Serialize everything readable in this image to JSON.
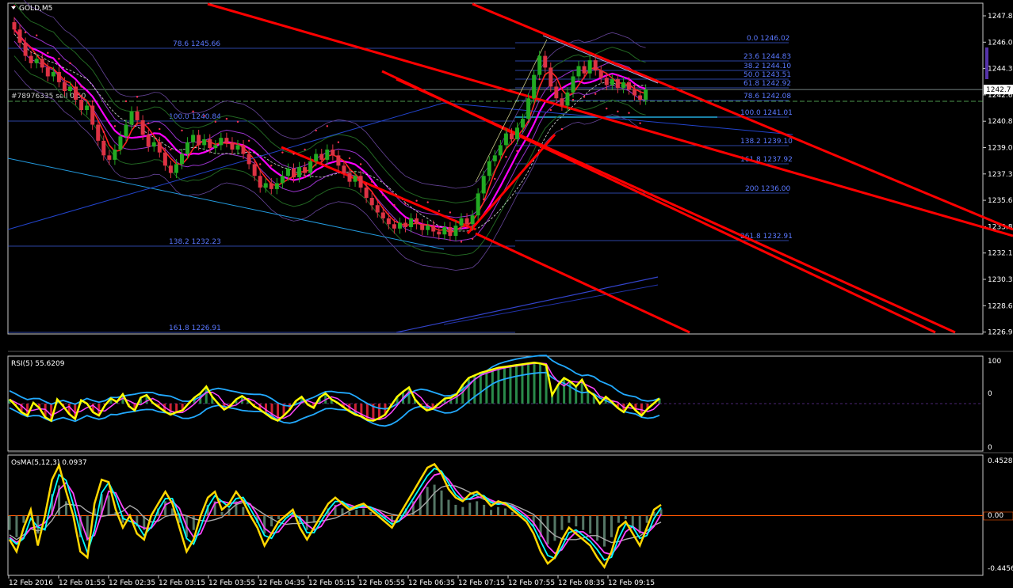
{
  "window": {
    "title": "GOLD,M5"
  },
  "colors": {
    "background": "#000000",
    "frame": "#c8c8c8",
    "bull": "#22aa22",
    "bear": "#dd3344",
    "channel": "#ff0000",
    "fib": "#3a5bd9",
    "fib_text": "#5a78ff",
    "rsi_main": "#ffff00",
    "rsi_band": "#22aaff",
    "osma_main": "#ffd700",
    "osma_sig1": "#00ffff",
    "osma_sig2": "#ff44ff",
    "osma_sig3": "#aaaaaa",
    "zero_line": "#ff5500",
    "axis_text": "#ffffff"
  },
  "price_axis": {
    "ticks": [
      "1247.8",
      "1246.0",
      "1244.3",
      "1242.6",
      "1240.8",
      "1239.0",
      "1237.3",
      "1235.6",
      "1233.8",
      "1232.1",
      "1230.3",
      "1228.6",
      "1226.9"
    ],
    "current_price": "1242.7"
  },
  "fib_labels": [
    "0.0 1246.02",
    "23.6 1244.83",
    "38.2 1244.10",
    "50.0 1243.51",
    "61.8 1242.92",
    "78.6 1242.08",
    "100.0 1241.01",
    "138.2 1239.10",
    "161.8 1237.92",
    "200 1236.00",
    "261.8 1232.91",
    "78.6 1245.66",
    "100.0 1240.84",
    "138.2 1232.23",
    "161.8 1226.91"
  ],
  "order_label": "#78976335 sell 0.50",
  "rsi": {
    "label": "RSI(5) 55.6209",
    "ticks": [
      "100",
      "0",
      "0"
    ]
  },
  "osma": {
    "label": "OsMA(5,12,3) 0.0937",
    "ticks": [
      "0.4528",
      "0.00",
      "-0.4456"
    ]
  },
  "time_axis": [
    "12 Feb 2016",
    "12 Feb 01:55",
    "12 Feb 02:35",
    "12 Feb 03:15",
    "12 Feb 03:55",
    "12 Feb 04:35",
    "12 Feb 05:15",
    "12 Feb 05:55",
    "12 Feb 06:35",
    "12 Feb 07:15",
    "12 Feb 07:55",
    "12 Feb 08:35",
    "12 Feb 09:15"
  ],
  "chart_data": [
    {
      "type": "candlestick",
      "title": "GOLD,M5",
      "ylim": [
        1226.0,
        1248.6
      ],
      "close": [
        1246.8,
        1245.9,
        1245.0,
        1244.5,
        1244.8,
        1244.2,
        1243.6,
        1243.9,
        1243.2,
        1242.6,
        1242.9,
        1242.0,
        1241.3,
        1241.6,
        1240.3,
        1239.2,
        1238.2,
        1237.9,
        1238.6,
        1239.5,
        1240.3,
        1241.2,
        1240.6,
        1239.6,
        1238.8,
        1239.1,
        1238.4,
        1237.5,
        1237.0,
        1237.6,
        1238.3,
        1239.1,
        1239.6,
        1238.9,
        1239.3,
        1238.7,
        1238.9,
        1239.4,
        1239.1,
        1238.6,
        1238.9,
        1238.3,
        1237.6,
        1236.8,
        1236.0,
        1236.3,
        1235.9,
        1236.3,
        1236.8,
        1237.3,
        1236.7,
        1237.4,
        1237.0,
        1237.8,
        1238.3,
        1237.9,
        1238.6,
        1238.2,
        1237.5,
        1237.0,
        1236.4,
        1236.8,
        1236.0,
        1235.3,
        1234.8,
        1234.3,
        1233.9,
        1233.5,
        1233.2,
        1233.6,
        1233.3,
        1233.9,
        1233.5,
        1233.1,
        1233.4,
        1233.0,
        1232.8,
        1233.3,
        1232.7,
        1233.4,
        1233.9,
        1233.5,
        1234.1,
        1235.6,
        1236.8,
        1237.8,
        1238.2,
        1238.9,
        1239.7,
        1239.3,
        1240.1,
        1240.7,
        1242.1,
        1243.7,
        1245.0,
        1244.2,
        1242.9,
        1242.1,
        1241.6,
        1242.5,
        1243.6,
        1244.3,
        1243.8,
        1244.7,
        1244.0,
        1243.5,
        1243.0,
        1243.4,
        1242.8,
        1243.2,
        1242.7,
        1242.3,
        1242.0,
        1242.7
      ]
    },
    {
      "type": "line",
      "title": "RSI(5) 55.6209",
      "ylim": [
        0,
        100
      ],
      "series": [
        {
          "values": [
            55,
            48,
            40,
            36,
            51,
            45,
            34,
            30,
            55,
            47,
            38,
            32,
            54,
            50,
            40,
            36,
            48,
            56,
            52,
            61,
            47,
            42,
            57,
            60,
            51,
            46,
            41,
            37,
            40,
            42,
            50,
            57,
            62,
            70,
            58,
            50,
            43,
            47,
            55,
            59,
            54,
            47,
            43,
            38,
            33,
            30,
            36,
            43,
            53,
            58,
            49,
            45,
            57,
            62,
            55,
            51,
            46,
            41,
            37,
            35,
            31,
            30,
            33,
            37,
            48,
            58,
            64,
            69,
            55,
            47,
            42,
            44,
            50,
            56,
            57,
            61,
            72,
            80,
            83,
            86,
            88,
            90,
            92,
            93,
            94,
            95,
            96,
            97,
            98,
            97,
            95,
            60,
            72,
            80,
            76,
            70,
            78,
            65,
            60,
            50,
            58,
            52,
            45,
            40,
            50,
            42,
            36,
            44,
            50,
            56
          ]
        }
      ]
    },
    {
      "type": "line",
      "title": "OsMA(5,12,3) 0.0937",
      "ylim": [
        -0.4456,
        0.4528
      ],
      "series": [
        {
          "values": [
            -0.2,
            -0.3,
            -0.1,
            0.05,
            -0.25,
            0.0,
            0.3,
            0.42,
            0.2,
            0.0,
            -0.3,
            -0.35,
            0.1,
            0.3,
            0.28,
            0.05,
            -0.1,
            0.0,
            -0.15,
            -0.2,
            0.0,
            0.1,
            0.2,
            0.1,
            -0.1,
            -0.3,
            -0.2,
            0.0,
            0.15,
            0.2,
            0.05,
            0.1,
            0.2,
            0.12,
            0.0,
            -0.1,
            -0.25,
            -0.15,
            -0.05,
            0.0,
            0.05,
            -0.1,
            -0.2,
            -0.1,
            0.0,
            0.1,
            0.15,
            0.1,
            0.05,
            0.08,
            0.1,
            0.05,
            0.0,
            -0.05,
            -0.1,
            0.0,
            0.1,
            0.2,
            0.3,
            0.4,
            0.43,
            0.35,
            0.22,
            0.15,
            0.12,
            0.18,
            0.2,
            0.15,
            0.08,
            0.12,
            0.1,
            0.05,
            0.0,
            -0.05,
            -0.15,
            -0.3,
            -0.4,
            -0.35,
            -0.2,
            -0.1,
            -0.15,
            -0.2,
            -0.25,
            -0.35,
            -0.43,
            -0.3,
            -0.1,
            -0.05,
            -0.15,
            -0.25,
            -0.1,
            0.05,
            0.09
          ]
        }
      ]
    }
  ]
}
